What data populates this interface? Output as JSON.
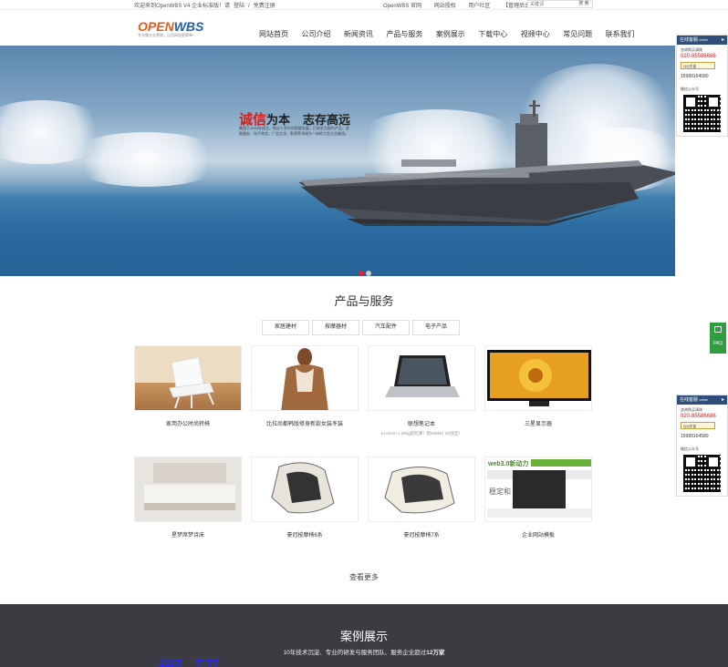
{
  "topbar": {
    "welcome": "欢迎来到OpenWBS V4 企业标准版！请",
    "login": "登陆",
    "sep": "/",
    "register": "免费注册",
    "links": [
      "OpenWBS 官网",
      "网站授权",
      "用户社区",
      "【管理后台】"
    ],
    "search_placeholder": "关键词",
    "search_button": "搜 索"
  },
  "logo": {
    "name_a": "OPEN",
    "name_b": "WBS",
    "slogan": "专业做企业营销，让您网站更简单！"
  },
  "nav": {
    "items": [
      "网站首页",
      "公司介绍",
      "新闻资讯",
      "产品与服务",
      "案例展示",
      "下载中心",
      "视频中心",
      "常见问题",
      "联系我们"
    ]
  },
  "hero": {
    "slogan_red": "诚信",
    "slogan_rest": "为本",
    "slogan_right": "志存高远",
    "body": "集团于1994年成立，经过十多年的稳健发展，已成长为国内产品、金融服务、电子商务、广告文化、影视等领域为一体的大型企业集团。",
    "dots": 2,
    "active_dot": 0
  },
  "float_panel": {
    "title": "在线客服",
    "title_en": "online",
    "phone_label": "咨询购买请拨",
    "phone": "020-85586686",
    "qq_label": "QQ交谈",
    "mobile": "15989164580",
    "wechat_label": "微信公众号"
  },
  "faq": {
    "label": "FAQ"
  },
  "products": {
    "title": "产品与服务",
    "categories": [
      "家居建材",
      "按摩器材",
      "汽车配件",
      "电子产品"
    ],
    "items": [
      {
        "name": "家用办公时尚转椅",
        "sub": ""
      },
      {
        "name": "比拉尚都韩版修身新款女装冬装",
        "sub": ""
      },
      {
        "name": "联想笔记本",
        "sub": "14.8mm+1.29kg超轻薄！配940MX 2G独显！"
      },
      {
        "name": "三星显示器",
        "sub": ""
      },
      {
        "name": "星梦席梦诗床",
        "sub": ""
      },
      {
        "name": "豪冠按摩椅6系",
        "sub": ""
      },
      {
        "name": "豪冠按摩椅7系",
        "sub": ""
      },
      {
        "name": "企业网站模板",
        "sub": ""
      }
    ],
    "more": "查看更多"
  },
  "cases": {
    "title": "案例展示",
    "subtitle_pre": "10年技术沉淀、专业的研发与服务团队、服务企业超过",
    "subtitle_strong": "12万家",
    "big_text": "概研"
  },
  "web_tpl": {
    "brand": "web3.0新动力",
    "badge": "稳定和"
  },
  "colors": {
    "nav_text": "#333333",
    "logo_orange": "#e85a12",
    "logo_blue": "#1e5fae",
    "panel_header": "#2f4f7a",
    "phone_red": "#cc2222",
    "faq_green": "#2e9e3e",
    "case_bg": "#3a3c42",
    "dot_active": "#e02424",
    "dot_inactive": "#cccccc"
  }
}
